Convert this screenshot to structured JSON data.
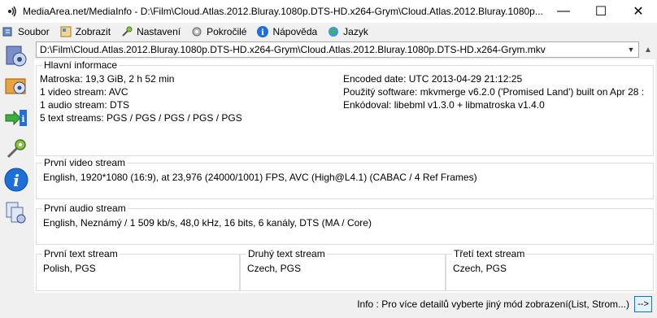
{
  "window": {
    "title": "MediaArea.net/MediaInfo - D:\\Film\\Cloud.Atlas.2012.Bluray.1080p.DTS-HD.x264-Grym\\Cloud.Atlas.2012.Bluray.1080p....",
    "minimize": "—",
    "maximize": "☐",
    "close": "✕"
  },
  "menu": {
    "items": [
      {
        "label": "Soubor",
        "icon": "file-icon"
      },
      {
        "label": "Zobrazit",
        "icon": "view-icon"
      },
      {
        "label": "Nastavení",
        "icon": "settings-icon"
      },
      {
        "label": "Pokročilé",
        "icon": "advanced-icon"
      },
      {
        "label": "Nápověda",
        "icon": "help-icon"
      },
      {
        "label": "Jazyk",
        "icon": "language-icon"
      }
    ]
  },
  "file_select": {
    "value": "D:\\Film\\Cloud.Atlas.2012.Bluray.1080p.DTS-HD.x264-Grym\\Cloud.Atlas.2012.Bluray.1080p.DTS-HD.x264-Grym.mkv"
  },
  "general": {
    "title": "Hlavní informace",
    "left": [
      "Matroska: 19,3 GiB, 2 h 52 min",
      "1 video stream: AVC",
      "1 audio stream: DTS",
      "5 text streams: PGS / PGS / PGS / PGS / PGS"
    ],
    "right": [
      "Encoded date: UTC 2013-04-29 21:12:25",
      "Použitý software: mkvmerge v6.2.0 ('Promised Land') built on Apr 28 :",
      "Enkódoval: libebml v1.3.0 + libmatroska v1.4.0"
    ]
  },
  "video": {
    "title": "První video stream",
    "text": "English, 1920*1080 (16:9), at 23,976 (24000/1001) FPS, AVC (High@L4.1) (CABAC / 4 Ref Frames)"
  },
  "audio": {
    "title": "První audio stream",
    "text": "English, Neznámý / 1 509 kb/s, 48,0 kHz, 16 bits, 6 kanály, DTS (MA / Core)"
  },
  "text_streams": [
    {
      "title": "První text stream",
      "text": "Polish, PGS"
    },
    {
      "title": "Druhý text stream",
      "text": "Czech, PGS"
    },
    {
      "title": "Třetí text stream",
      "text": "Czech, PGS"
    }
  ],
  "status": {
    "text": "Info : Pro více detailů vyberte jiný mód zobrazení(List, Strom...)",
    "button": "-->"
  }
}
